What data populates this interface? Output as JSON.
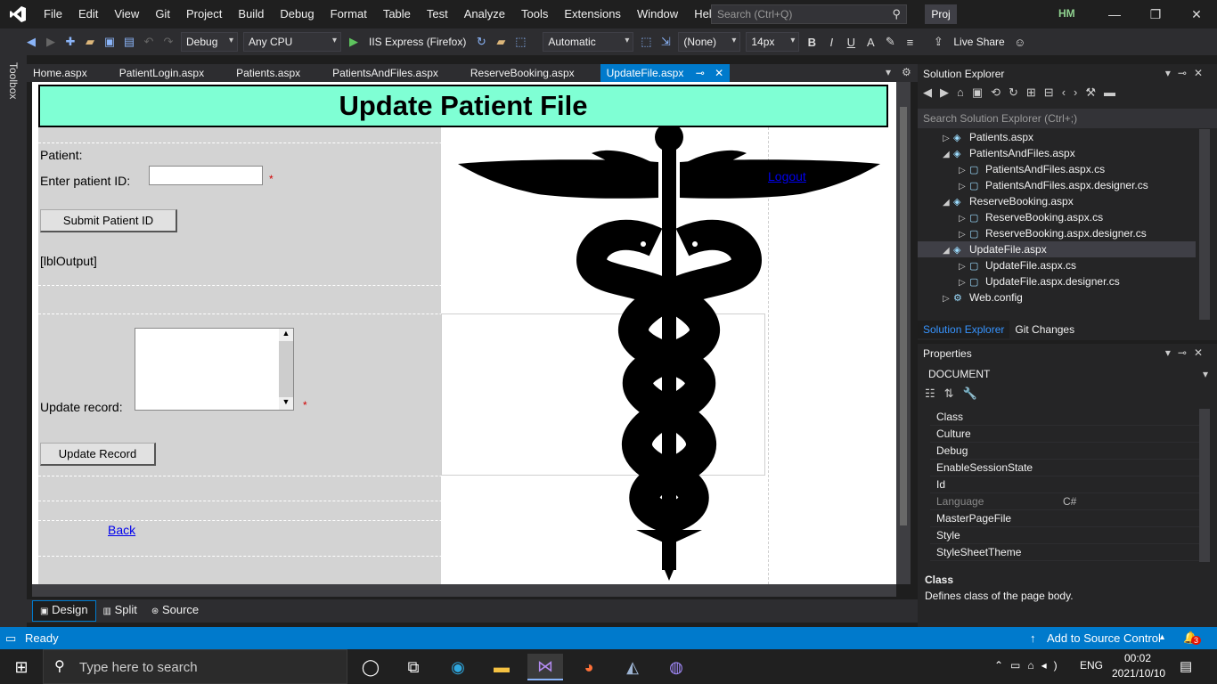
{
  "menubar": {
    "items": [
      "File",
      "Edit",
      "View",
      "Git",
      "Project",
      "Build",
      "Debug",
      "Format",
      "Table",
      "Test",
      "Analyze",
      "Tools",
      "Extensions",
      "Window",
      "Help"
    ],
    "search_placeholder": "Search (Ctrl+Q)",
    "project_label": "Proj",
    "user_initials": "HM"
  },
  "toolbar": {
    "configuration": "Debug",
    "platform": "Any CPU",
    "run_target": "IIS Express (Firefox)",
    "format_mode": "Automatic",
    "style_target": "(None)",
    "font_size": "14px",
    "live_share": "Live Share"
  },
  "toolbox_label": "Toolbox",
  "doc_tabs": [
    "Home.aspx",
    "PatientLogin.aspx",
    "Patients.aspx",
    "PatientsAndFiles.aspx",
    "ReserveBooking.aspx",
    "UpdateFile.aspx"
  ],
  "designer": {
    "title": "Update Patient File",
    "patient_label": "Patient:",
    "enter_id_label": "Enter patient ID:",
    "required_mark": "*",
    "submit_button": "Submit Patient ID",
    "output_label": "[lblOutput]",
    "update_record_label": "Update record:",
    "update_button": "Update Record",
    "back_link": "Back",
    "logout_link": "Logout"
  },
  "solution_explorer": {
    "title": "Solution Explorer",
    "search_placeholder": "Search Solution Explorer (Ctrl+;)",
    "items": [
      {
        "label": "Patients.aspx",
        "arrow": "▷"
      },
      {
        "label": "PatientsAndFiles.aspx",
        "arrow": "◢"
      },
      {
        "label": "PatientsAndFiles.aspx.cs",
        "arrow": "▷"
      },
      {
        "label": "PatientsAndFiles.aspx.designer.cs",
        "arrow": "▷"
      },
      {
        "label": "ReserveBooking.aspx",
        "arrow": "◢"
      },
      {
        "label": "ReserveBooking.aspx.cs",
        "arrow": "▷"
      },
      {
        "label": "ReserveBooking.aspx.designer.cs",
        "arrow": "▷"
      },
      {
        "label": "UpdateFile.aspx",
        "arrow": "◢"
      },
      {
        "label": "UpdateFile.aspx.cs",
        "arrow": "▷"
      },
      {
        "label": "UpdateFile.aspx.designer.cs",
        "arrow": "▷"
      },
      {
        "label": "Web.config",
        "arrow": "▷"
      }
    ],
    "bottom_tabs": [
      "Solution Explorer",
      "Git Changes"
    ]
  },
  "properties": {
    "title": "Properties",
    "object": "DOCUMENT",
    "rows": [
      {
        "name": "Class",
        "value": ""
      },
      {
        "name": "Culture",
        "value": ""
      },
      {
        "name": "Debug",
        "value": ""
      },
      {
        "name": "EnableSessionState",
        "value": ""
      },
      {
        "name": "Id",
        "value": ""
      },
      {
        "name": "Language",
        "value": "C#"
      },
      {
        "name": "MasterPageFile",
        "value": ""
      },
      {
        "name": "Style",
        "value": ""
      },
      {
        "name": "StyleSheetTheme",
        "value": ""
      }
    ],
    "desc_title": "Class",
    "desc_text": "Defines class of the page body."
  },
  "view_tabs": [
    "Design",
    "Split",
    "Source"
  ],
  "status": {
    "ready": "Ready",
    "source_control": "Add to Source Control",
    "notifications": "3"
  },
  "taskbar": {
    "search_placeholder": "Type here to search",
    "language": "ENG",
    "time": "00:02",
    "date": "2021/10/10"
  }
}
